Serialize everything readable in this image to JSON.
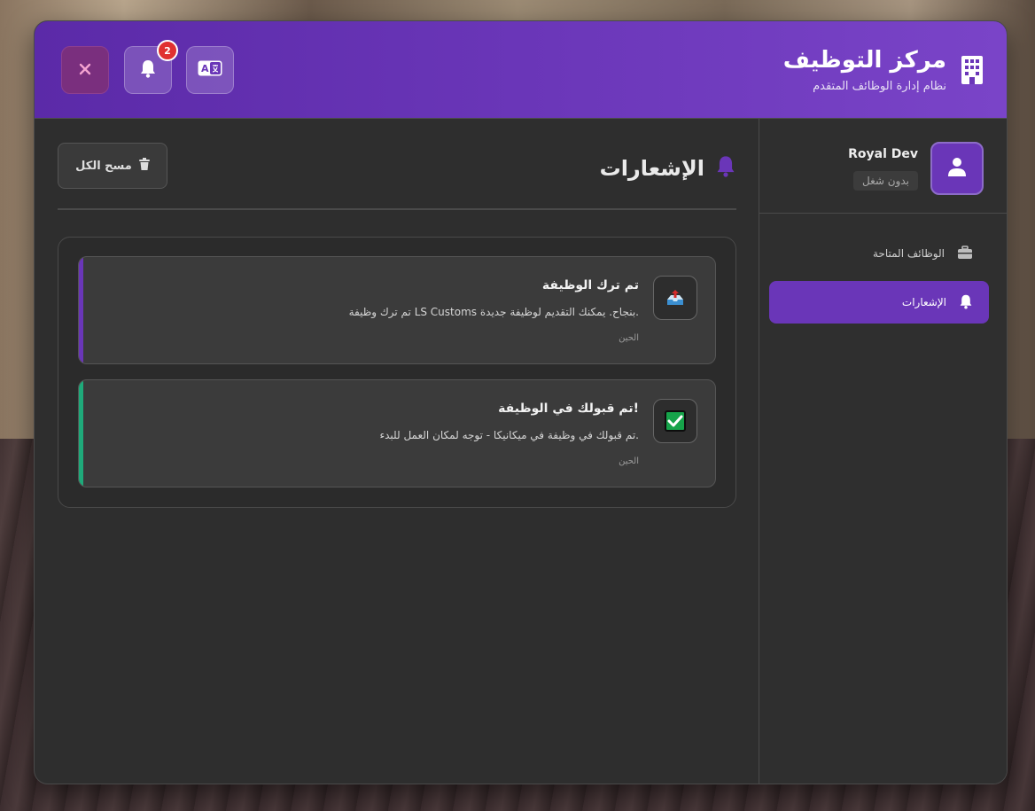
{
  "header": {
    "title": "مركز التوظيف",
    "subtitle": "نظام إدارة الوظائف المتقدم",
    "notification_count": "2",
    "accent_color": "#6a36b8"
  },
  "sidebar": {
    "profile": {
      "name": "Royal Dev",
      "status": "بدون شغل"
    },
    "items": [
      {
        "label": "الوظائف المتاحة",
        "icon": "briefcase-icon",
        "active": false
      },
      {
        "label": "الإشعارات",
        "icon": "bell-icon",
        "active": true
      }
    ]
  },
  "main": {
    "section_title": "الإشعارات",
    "clear_all_label": "مسح الكل",
    "notifications": [
      {
        "title": "تم ترك الوظيفة",
        "message": "تم ترك وظيفة LS Customs بنجاح. يمكنك التقديم لوظيفة جديدة.",
        "time": "الحين",
        "icon": "outbox-tray-icon",
        "stripe_color": "#6a36b8"
      },
      {
        "title": "تم قبولك في الوظيفة!",
        "message": "تم قبولك في وظيفة في ميكانيكا - توجه لمكان العمل للبدء.",
        "time": "الحين",
        "icon": "check-mark-icon",
        "stripe_color": "#1faa7a"
      }
    ]
  }
}
